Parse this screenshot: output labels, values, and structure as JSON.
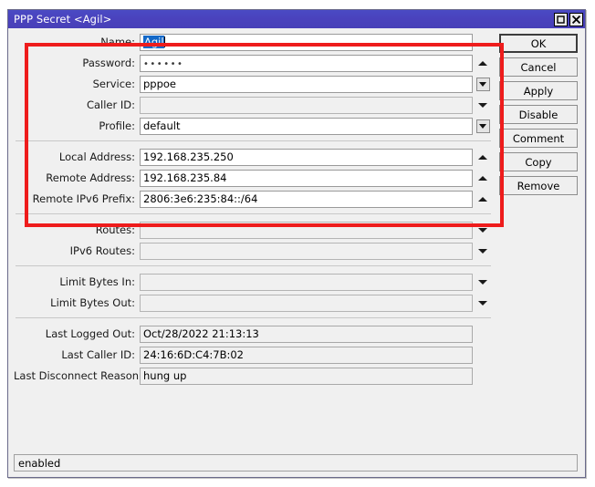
{
  "window": {
    "title": "PPP Secret <Agil>",
    "maximize_icon": "maximize-icon",
    "close_icon": "close-icon"
  },
  "form": {
    "groups": [
      {
        "id": "identity",
        "rows": [
          {
            "label": "Name:",
            "value": "Agil",
            "state": "selected",
            "arrow": "none"
          },
          {
            "label": "Password:",
            "value": "••••••",
            "state": "password",
            "arrow": "up"
          },
          {
            "label": "Service:",
            "value": "pppoe",
            "state": "normal",
            "arrow": "combo"
          },
          {
            "label": "Caller ID:",
            "value": "",
            "state": "disabled",
            "arrow": "down"
          },
          {
            "label": "Profile:",
            "value": "default",
            "state": "normal",
            "arrow": "combo"
          }
        ]
      },
      {
        "id": "addresses",
        "rows": [
          {
            "label": "Local Address:",
            "value": "192.168.235.250",
            "state": "normal",
            "arrow": "up"
          },
          {
            "label": "Remote Address:",
            "value": "192.168.235.84",
            "state": "normal",
            "arrow": "up"
          },
          {
            "label": "Remote IPv6 Prefix:",
            "value": "2806:3e6:235:84::/64",
            "state": "normal",
            "arrow": "up"
          }
        ]
      },
      {
        "id": "routes",
        "rows": [
          {
            "label": "Routes:",
            "value": "",
            "state": "disabled",
            "arrow": "down"
          },
          {
            "label": "IPv6 Routes:",
            "value": "",
            "state": "disabled",
            "arrow": "down"
          }
        ]
      },
      {
        "id": "limits",
        "rows": [
          {
            "label": "Limit Bytes In:",
            "value": "",
            "state": "disabled",
            "arrow": "down"
          },
          {
            "label": "Limit Bytes Out:",
            "value": "",
            "state": "disabled",
            "arrow": "down"
          }
        ]
      },
      {
        "id": "last-session",
        "rows": [
          {
            "label": "Last Logged Out:",
            "value": "Oct/28/2022 21:13:13",
            "state": "readonly",
            "arrow": "none"
          },
          {
            "label": "Last Caller ID:",
            "value": "24:16:6D:C4:7B:02",
            "state": "readonly",
            "arrow": "none"
          },
          {
            "label": "Last Disconnect Reason:",
            "value": "hung up",
            "state": "readonly",
            "arrow": "none"
          }
        ]
      }
    ]
  },
  "buttons": [
    {
      "label": "OK",
      "default": true
    },
    {
      "label": "Cancel",
      "default": false
    },
    {
      "label": "Apply",
      "default": false
    },
    {
      "label": "Disable",
      "default": false
    },
    {
      "label": "Comment",
      "default": false
    },
    {
      "label": "Copy",
      "default": false
    },
    {
      "label": "Remove",
      "default": false
    }
  ],
  "statusbar": {
    "text": "enabled"
  },
  "annotation": {
    "color": "#ee1c1c"
  }
}
